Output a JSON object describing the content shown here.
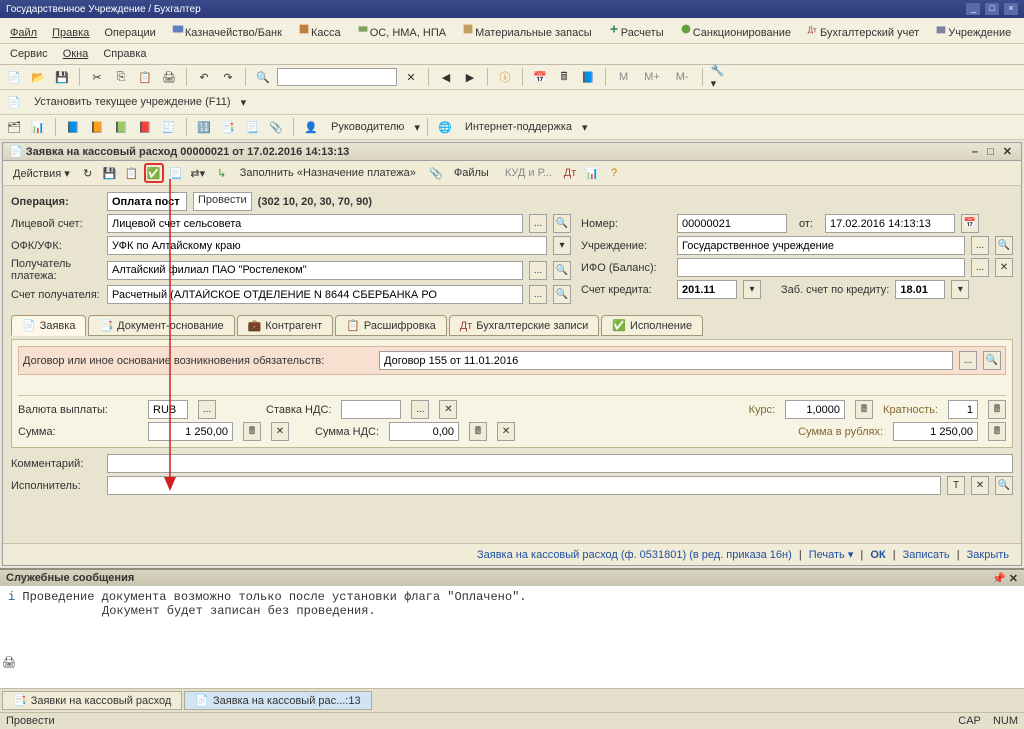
{
  "titlebar": "Государственное Учреждение / Бухгалтер",
  "mainMenu": {
    "file": "Файл",
    "edit": "Правка",
    "operations": "Операции",
    "treasury": "Казначейство/Банк",
    "cash": "Касса",
    "os": "ОС, НМА, НПА",
    "materials": "Материальные запасы",
    "calc": "Расчеты",
    "sanction": "Санкционирование",
    "accounting": "Бухгалтерский учет",
    "institution": "Учреждение",
    "service": "Сервис",
    "windows": "Окна",
    "help": "Справка"
  },
  "toolbar": {
    "setCurrentInst": "Установить текущее учреждение (F11)",
    "ruler": "Руководителю",
    "support": "Интернет-поддержка"
  },
  "doc": {
    "title": "Заявка на кассовый расход 00000021 от 17.02.2016 14:13:13",
    "actions": "Действия",
    "fill": "Заполнить «Назначение платежа»",
    "files": "Файлы",
    "kudir": "КУД и Р...",
    "operationLabel": "Операция:",
    "operation": "Оплата пост",
    "provesti": "Провести",
    "operationCode": "(302 10, 20, 30, 70, 90)",
    "account_label": "Лицевой счет:",
    "account": "Лицевой счет сельсовета",
    "ofk_label": "ОФК/УФК:",
    "ofk": "УФК по Алтайскому краю",
    "payee_label": "Получатель платежа:",
    "payee": "Алтайский филиал ПАО \"Ростелеком\"",
    "payee_acc_label": "Счет получателя:",
    "payee_acc": "Расчетный (АЛТАЙСКОЕ ОТДЕЛЕНИЕ N 8644 СБЕРБАНКА РО",
    "number_label": "Номер:",
    "number": "00000021",
    "date_label": "от:",
    "date": "17.02.2016 14:13:13",
    "inst_label": "Учреждение:",
    "inst": "Государственное учреждение",
    "ifo_label": "ИФО (Баланс):",
    "ifo": "",
    "credit_label": "Счет кредита:",
    "credit": "201.11",
    "offbal_label": "Заб. счет по кредиту:",
    "offbal": "18.01",
    "tabs": {
      "request": "Заявка",
      "docbase": "Документ-основание",
      "counterparty": "Контрагент",
      "decryption": "Расшифровка",
      "accounting": "Бухгалтерские записи",
      "execution": "Исполнение"
    },
    "contract_label": "Договор или иное основание возникновения обязательств:",
    "contract": "Договор 155 от 11.01.2016",
    "currency_label": "Валюта выплаты:",
    "currency": "RUB",
    "vat_rate_label": "Ставка НДС:",
    "vat_rate": "",
    "sum_label": "Сумма:",
    "sum": "1 250,00",
    "vat_sum_label": "Сумма НДС:",
    "vat_sum": "0,00",
    "rate_label": "Курс:",
    "rate": "1,0000",
    "mult_label": "Кратность:",
    "mult": "1",
    "sum_rub_label": "Сумма в рублях:",
    "sum_rub": "1 250,00",
    "comment_label": "Комментарий:",
    "executor_label": "Исполнитель:",
    "form_info": "Заявка на кассовый расход (ф. 0531801) (в ред. приказа 16н)",
    "print": "Печать",
    "ok": "ОК",
    "save": "Записать",
    "close": "Закрыть"
  },
  "serviceMsgs": {
    "title": "Служебные сообщения",
    "line1": "Проведение документа возможно только после установки флага \"Оплачено\".",
    "line2": "Документ будет записан без проведения."
  },
  "bottomTabs": {
    "t1": "Заявки на кассовый расход",
    "t2": "Заявка на кассовый рас...:13"
  },
  "appStatus": {
    "hint": "Провести",
    "cap": "CAP",
    "num": "NUM"
  }
}
